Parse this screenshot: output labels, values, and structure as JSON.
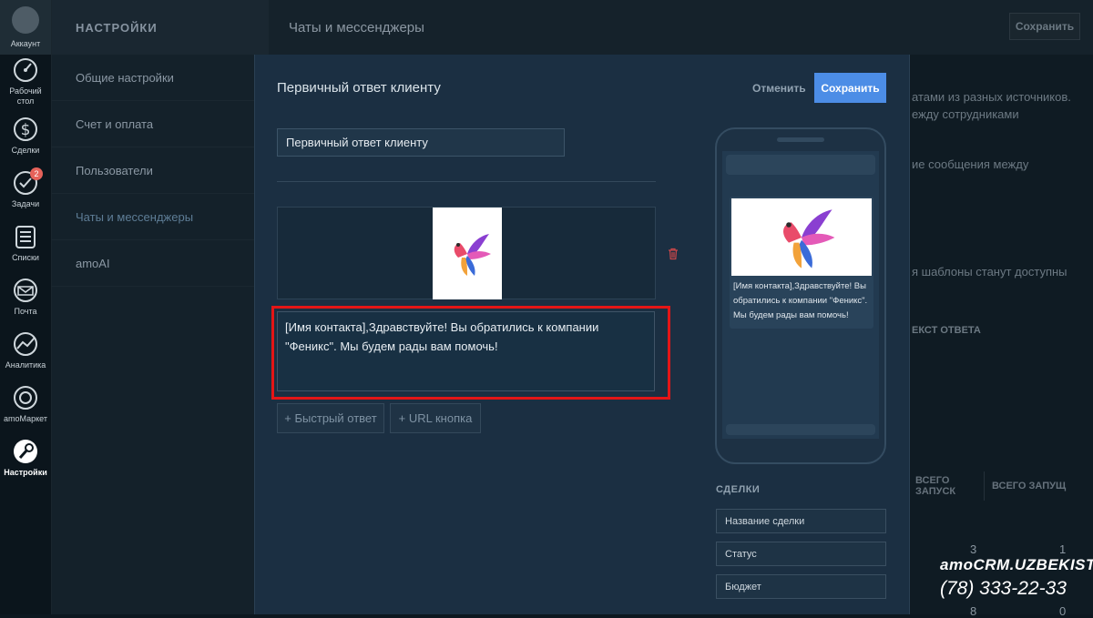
{
  "rail": {
    "account_label": "Аккаунт",
    "items": [
      {
        "label": "Рабочий стол",
        "icon": "dashboard-icon"
      },
      {
        "label": "Сделки",
        "icon": "dollar-icon"
      },
      {
        "label": "Задачи",
        "icon": "check-icon",
        "badge": "2"
      },
      {
        "label": "Списки",
        "icon": "lists-icon"
      },
      {
        "label": "Почта",
        "icon": "mail-icon"
      },
      {
        "label": "Аналитика",
        "icon": "analytics-icon"
      },
      {
        "label": "amoМаркет",
        "icon": "market-icon"
      },
      {
        "label": "Настройки",
        "icon": "wrench-icon",
        "active": true
      }
    ]
  },
  "submenu": {
    "heading": "НАСТРОЙКИ",
    "items": [
      "Общие настройки",
      "Счет и оплата",
      "Пользователи",
      "Чаты и мессенджеры",
      "amoAI"
    ],
    "active_index": 3
  },
  "page": {
    "title": "Чаты и мессенджеры",
    "save_label": "Сохранить",
    "bg_lines": [
      "атами из разных источников.",
      "ежду сотрудниками",
      "ие сообщения между",
      "я шаблоны станут доступны",
      "ЕКСТ ОТВЕТА"
    ],
    "bg_cols": [
      "ВСЕГО ЗАПУСК",
      "ВСЕГО ЗАПУЩ"
    ],
    "bg_numbers": [
      "3",
      "1",
      "8",
      "0"
    ]
  },
  "modal": {
    "title": "Первичный ответ клиенту",
    "cancel_label": "Отменить",
    "save_label": "Сохранить",
    "name_value": "Первичный ответ клиенту",
    "message_text": "[Имя контакта],Здравствуйте! Вы обратились к компании \"Феникс\". Мы будем рады вам помочь!",
    "quick_reply_label": "+ Быстрый ответ",
    "url_button_label": "+ URL кнопка",
    "preview_text": "[Имя контакта],Здравствуйте! Вы обратились к компании \"Феникс\". Мы будем рады вам помочь!",
    "deals_heading": "СДЕЛКИ",
    "deal_fields": [
      "Название сделки",
      "Статус",
      "Бюджет"
    ]
  },
  "watermark": {
    "brand": "amoCRM.UZBEKISTAN",
    "phone": "(78) 333-22-33"
  },
  "colors": {
    "accent": "#4c8de6",
    "highlight_frame": "#e41516",
    "badge": "#e6625a"
  }
}
